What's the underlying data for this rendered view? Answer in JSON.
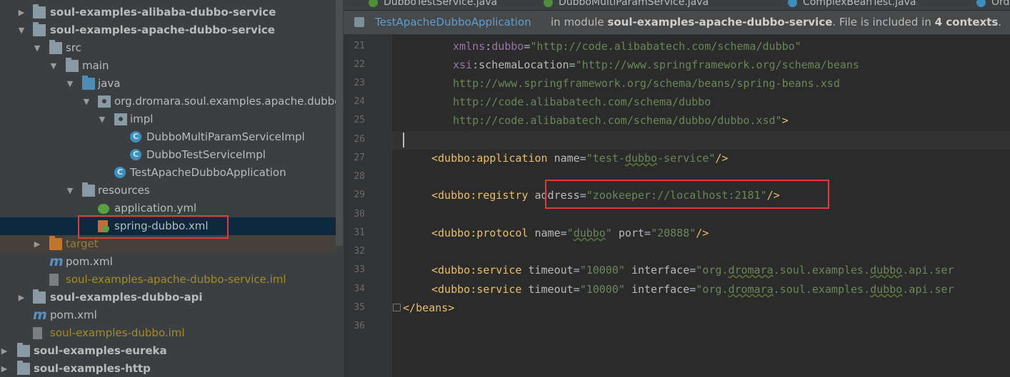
{
  "tree": {
    "items": [
      {
        "label": "soul-examples-alibaba-dubbo-service"
      },
      {
        "label": "soul-examples-apache-dubbo-service"
      },
      {
        "label": "src"
      },
      {
        "label": "main"
      },
      {
        "label": "java"
      },
      {
        "label": "org.dromara.soul.examples.apache.dubbo.se"
      },
      {
        "label": "impl"
      },
      {
        "label": "DubboMultiParamServiceImpl"
      },
      {
        "label": "DubboTestServiceImpl"
      },
      {
        "label": "TestApacheDubboApplication"
      },
      {
        "label": "resources"
      },
      {
        "label": "application.yml"
      },
      {
        "label": "spring-dubbo.xml"
      },
      {
        "label": "target"
      },
      {
        "label": "pom.xml"
      },
      {
        "label": "soul-examples-apache-dubbo-service.iml"
      },
      {
        "label": "soul-examples-dubbo-api"
      },
      {
        "label": "pom.xml"
      },
      {
        "label": "soul-examples-dubbo.iml"
      },
      {
        "label": "soul-examples-eureka"
      },
      {
        "label": "soul-examples-http"
      }
    ]
  },
  "tabs": [
    {
      "label": "DubboTestService.java"
    },
    {
      "label": "DubboMultiParamService.java"
    },
    {
      "label": "ComplexBeanTest.java"
    },
    {
      "label": "Ord"
    }
  ],
  "infobar": {
    "app": "TestApacheDubboApplication",
    "pre": "in module ",
    "module": "soul-examples-apache-dubbo-service",
    "mid": ". File is included in ",
    "contexts": "4 contexts",
    "end": "."
  },
  "editor": {
    "line_numbers": [
      "21",
      "22",
      "23",
      "24",
      "25",
      "26",
      "27",
      "28",
      "29",
      "30",
      "31",
      "32",
      "33",
      "34",
      "35",
      "36"
    ],
    "code": {
      "l21_ns": "xmlns",
      "l21_p": "dubbo",
      "l21_v": "\"http://code.alibabatech.com/schema/dubbo\"",
      "l22_ns": "xsi",
      "l22_attr": "schemaLocation",
      "l22_v": "\"http://www.springframework.org/schema/beans",
      "l23": "http://www.springframework.org/schema/beans/spring-beans.xsd",
      "l24": "http://code.alibabatech.com/schema/dubbo",
      "l25": "http://code.alibabatech.com/schema/dubbo/dubbo.xsd\"",
      "l27_tag": "application",
      "l27_attr": "name",
      "l27_v1": "\"test-",
      "l27_v2": "dubbo",
      "l27_v3": "-service\"",
      "l29_tag": "registry",
      "l29_attr": "address",
      "l29_v": "\"zookeeper://localhost:2181\"",
      "l31_tag": "protocol",
      "l31_attr1": "name",
      "l31_v1a": "\"",
      "l31_v1b": "dubbo",
      "l31_v1c": "\"",
      "l31_attr2": "port",
      "l31_v2": "\"20888\"",
      "l33_tag": "service",
      "l33_attr1": "timeout",
      "l33_v1": "\"10000\"",
      "l33_attr2": "interface",
      "l33_v2a": "\"org.",
      "l33_v2b": "dromara",
      "l33_v2c": ".soul.examples.",
      "l33_v2d": "dubbo",
      "l33_v2e": ".api.ser",
      "l35_tag": "beans"
    }
  },
  "colors": {
    "highlight_box": "#e03a3a",
    "selection": "#0d293e",
    "xml_tag": "#e8bf6a",
    "xml_value": "#6a8759",
    "namespace": "#9876aa"
  }
}
